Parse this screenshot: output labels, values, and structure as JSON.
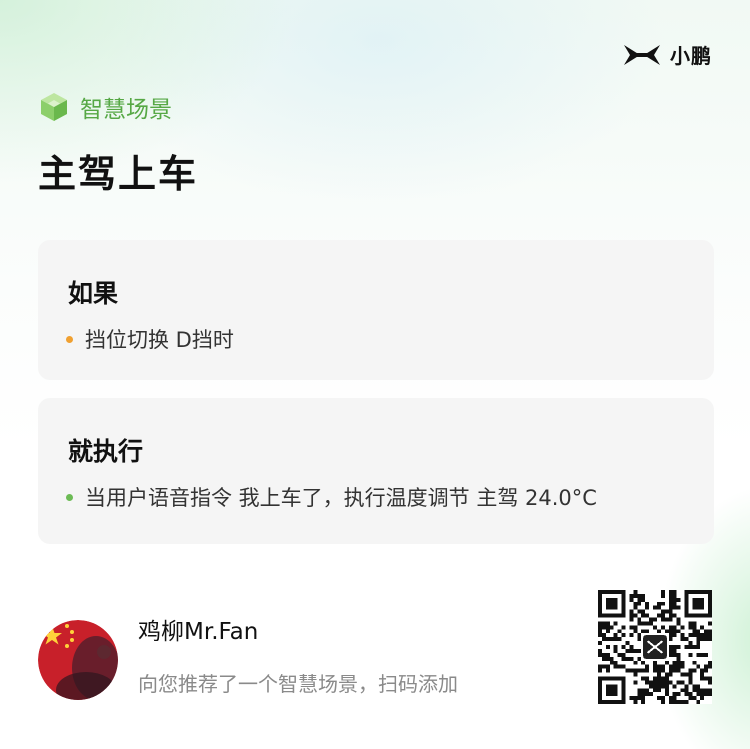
{
  "brand": {
    "name": "小鹏",
    "logo_icon": "xpeng-logo-icon"
  },
  "scene": {
    "tag_label": "智慧场景",
    "tag_icon": "cube-icon",
    "title": "主驾上车"
  },
  "condition_card": {
    "heading": "如果",
    "item": "挡位切换 D挡时",
    "dot_color": "#f0a030"
  },
  "action_card": {
    "heading": "就执行",
    "item": "当用户语音指令 我上车了，执行温度调节 主驾 24.0°C",
    "dot_color": "#6cbb55"
  },
  "author": {
    "name": "鸡柳Mr.Fan",
    "subtitle": "向您推荐了一个智慧场景，扫码添加",
    "avatar_icon": "flag-avatar"
  },
  "qr": {
    "icon": "qr-code"
  },
  "colors": {
    "accent_green": "#56a845",
    "card_bg": "#f4f4f4"
  }
}
